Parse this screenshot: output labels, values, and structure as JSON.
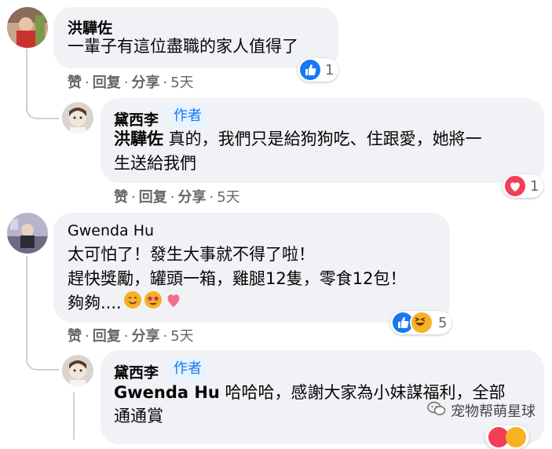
{
  "comments": [
    {
      "author": "洪驊佐",
      "text": "一輩子有這位盡職的家人值得了",
      "actions": {
        "like": "赞",
        "reply": "回复",
        "share": "分享",
        "time": "5天"
      },
      "reaction_count": "1",
      "replies": [
        {
          "author": "黛西李",
          "badge": "作者",
          "mention": "洪驊佐",
          "line1": " 真的，我們只是給狗狗吃、住跟愛，她將一",
          "line2": "生送給我們",
          "actions": {
            "like": "赞",
            "reply": "回复",
            "share": "分享",
            "time": "5天"
          },
          "reaction_count": "1"
        }
      ]
    },
    {
      "author": "Gwenda Hu",
      "line1": "太可怕了！發生大事就不得了啦！",
      "line2": "趕快獎勵，罐頭一箱，雞腿12隻，零食12包！",
      "line3": "夠夠....",
      "actions": {
        "like": "赞",
        "reply": "回复",
        "share": "分享",
        "time": "5天"
      },
      "reaction_count": "5",
      "replies": [
        {
          "author": "黛西李",
          "badge": "作者",
          "mention": "Gwenda Hu",
          "line1": " 哈哈哈，感謝大家為小妹謀福利，全部",
          "line2": "通通賞"
        }
      ]
    }
  ],
  "watermark": "宠物帮萌星球",
  "colors": {
    "bubble": "#f0f2f5",
    "like_blue": "#1877f2",
    "love_red": "#f33e58",
    "haha_yellow": "#f7b125",
    "meta_gray": "#65676b"
  }
}
